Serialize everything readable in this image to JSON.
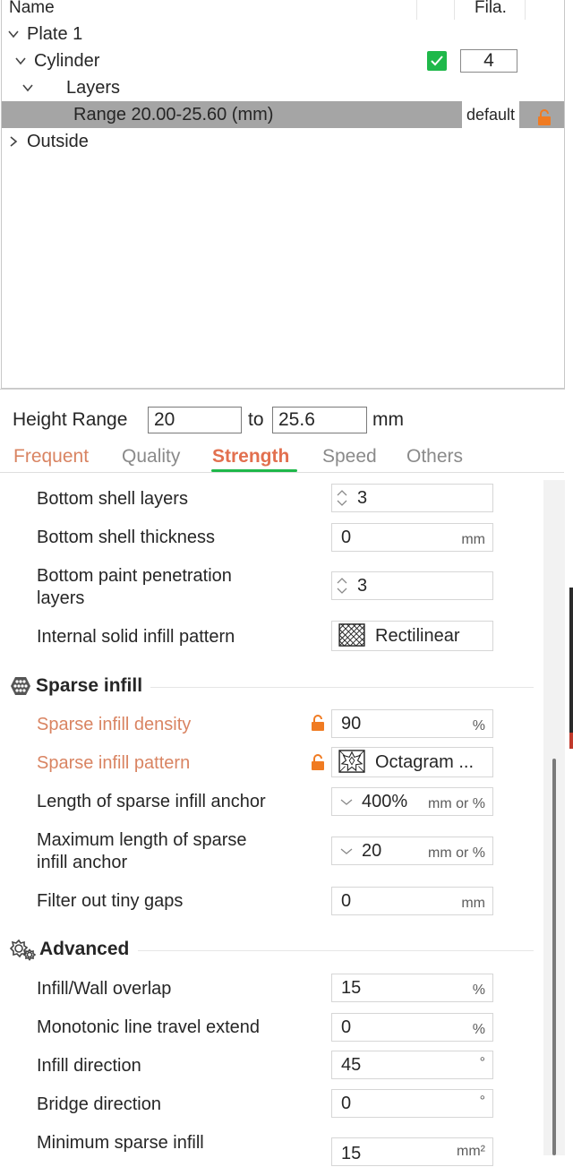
{
  "tree": {
    "header": {
      "name": "Name",
      "fila": "Fila."
    },
    "rows": [
      {
        "label": "Plate 1"
      },
      {
        "label": "Cylinder",
        "filament": "4"
      },
      {
        "label": "Layers"
      },
      {
        "label": "Range 20.00-25.60 (mm)",
        "extruder": "default"
      },
      {
        "label": "Outside"
      }
    ]
  },
  "height_range": {
    "label": "Height Range",
    "from": "20",
    "to_label": "to",
    "to": "25.6",
    "unit": "mm"
  },
  "tabs": [
    {
      "label": "Frequent"
    },
    {
      "label": "Quality"
    },
    {
      "label": "Strength",
      "active": true
    },
    {
      "label": "Speed"
    },
    {
      "label": "Others"
    }
  ],
  "settings": {
    "bottom_shell_layers": {
      "label": "Bottom shell layers",
      "value": "3"
    },
    "bottom_shell_thickness": {
      "label": "Bottom shell thickness",
      "value": "0",
      "unit": "mm"
    },
    "bottom_paint_penetration": {
      "label_line1": "Bottom paint penetration",
      "label_line2": "layers",
      "value": "3"
    },
    "internal_solid_infill_pattern": {
      "label": "Internal solid infill pattern",
      "value": "Rectilinear"
    },
    "sparse_section": {
      "title": "Sparse infill"
    },
    "sparse_infill_density": {
      "label": "Sparse infill density",
      "value": "90",
      "unit": "%"
    },
    "sparse_infill_pattern": {
      "label": "Sparse infill pattern",
      "value": "Octagram ..."
    },
    "sparse_anchor_length": {
      "label": "Length of sparse infill anchor",
      "value": "400%",
      "unit": "mm or %"
    },
    "sparse_anchor_max": {
      "label_line1": "Maximum length of sparse",
      "label_line2": "infill anchor",
      "value": "20",
      "unit": "mm or %"
    },
    "filter_gaps": {
      "label": "Filter out tiny gaps",
      "value": "0",
      "unit": "mm"
    },
    "advanced_section": {
      "title": "Advanced"
    },
    "infill_wall_overlap": {
      "label": "Infill/Wall overlap",
      "value": "15",
      "unit": "%"
    },
    "monotonic_extend": {
      "label": "Monotonic line travel extend",
      "value": "0",
      "unit": "%"
    },
    "infill_direction": {
      "label": "Infill direction",
      "value": "45",
      "unit": "°"
    },
    "bridge_direction": {
      "label": "Bridge direction",
      "value": "0",
      "unit": "°"
    },
    "min_sparse_infill": {
      "label": "Minimum sparse infill",
      "value": "15",
      "unit": "mm²"
    }
  },
  "colors": {
    "accent_green": "#1fb84a",
    "modified_orange": "#d98462",
    "lock_orange": "#f07b22",
    "selection_gray": "#a5a5a5"
  }
}
